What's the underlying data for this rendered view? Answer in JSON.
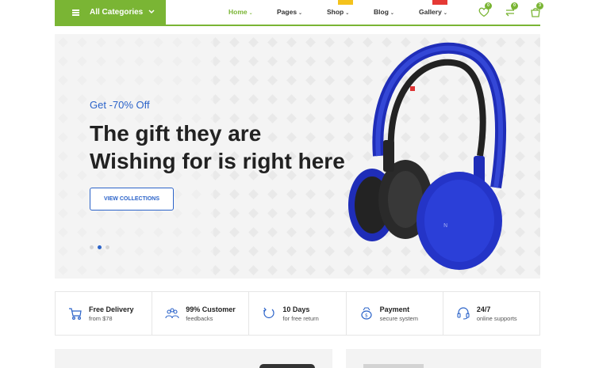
{
  "header": {
    "categories_label": "All Categories",
    "menu": [
      {
        "label": "Home",
        "active": true
      },
      {
        "label": "Pages",
        "active": false
      },
      {
        "label": "Shop",
        "active": false
      },
      {
        "label": "Blog",
        "active": false
      },
      {
        "label": "Gallery",
        "active": false
      }
    ],
    "icons": [
      {
        "name": "wishlist-heart-icon",
        "count": "0"
      },
      {
        "name": "compare-arrows-icon",
        "count": "0"
      },
      {
        "name": "cart-bag-icon",
        "count": "3"
      }
    ],
    "accent_color": "#7ab534"
  },
  "hero": {
    "promo": "Get -70% Off",
    "headline_line1": "The gift they are",
    "headline_line2": "Wishing for is right here",
    "cta_label": "VIEW COLLECTIONS",
    "slide_count": 3,
    "active_slide": 2,
    "product_image": "blue-headphones",
    "accent_color": "#2b63c9"
  },
  "features": [
    {
      "icon": "delivery-cart-icon",
      "title": "Free Delivery",
      "subtitle": "from $78"
    },
    {
      "icon": "customer-group-icon",
      "title": "99% Customer",
      "subtitle": "feedbacks"
    },
    {
      "icon": "return-arrow-icon",
      "title": "10 Days",
      "subtitle": "for free return"
    },
    {
      "icon": "payment-bag-icon",
      "title": "Payment",
      "subtitle": "secure system"
    },
    {
      "icon": "support-headset-icon",
      "title": "24/7",
      "subtitle": "online supports"
    }
  ]
}
